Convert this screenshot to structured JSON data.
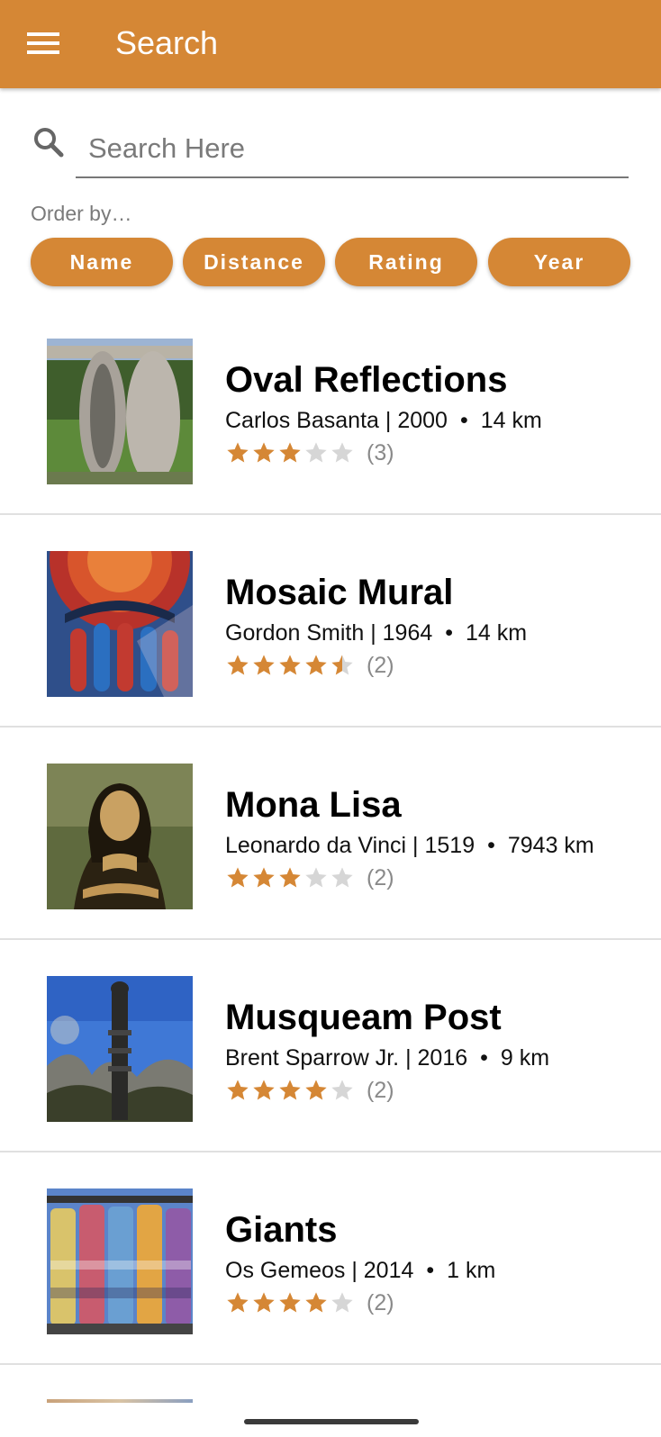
{
  "appbar": {
    "title": "Search",
    "menu_icon": "menu-icon"
  },
  "search": {
    "placeholder": "Search Here",
    "value": "",
    "icon": "search-icon"
  },
  "order_by": {
    "label": "Order by…",
    "options": [
      "Name",
      "Distance",
      "Rating",
      "Year"
    ]
  },
  "colors": {
    "accent": "#D58735",
    "star_empty": "#d6d6d6"
  },
  "items": [
    {
      "title": "Oval Reflections",
      "artist": "Carlos Basanta",
      "year": "2000",
      "distance": "14 km",
      "rating": 3,
      "reviews": "(3)",
      "thumbnail": "stone-sculpture-image"
    },
    {
      "title": "Mosaic Mural",
      "artist": "Gordon Smith",
      "year": "1964",
      "distance": "14 km",
      "rating": 4.5,
      "reviews": "(2)",
      "thumbnail": "mosaic-image"
    },
    {
      "title": "Mona Lisa",
      "artist": "Leonardo da Vinci",
      "year": "1519",
      "distance": "7943 km",
      "rating": 3,
      "reviews": "(2)",
      "thumbnail": "painting-image"
    },
    {
      "title": "Musqueam Post",
      "artist": "Brent Sparrow Jr.",
      "year": "2016",
      "distance": "9 km",
      "rating": 4,
      "reviews": "(2)",
      "thumbnail": "carved-post-image"
    },
    {
      "title": "Giants",
      "artist": "Os Gemeos",
      "year": "2014",
      "distance": "1 km",
      "rating": 4,
      "reviews": "(2)",
      "thumbnail": "silo-mural-image"
    }
  ]
}
